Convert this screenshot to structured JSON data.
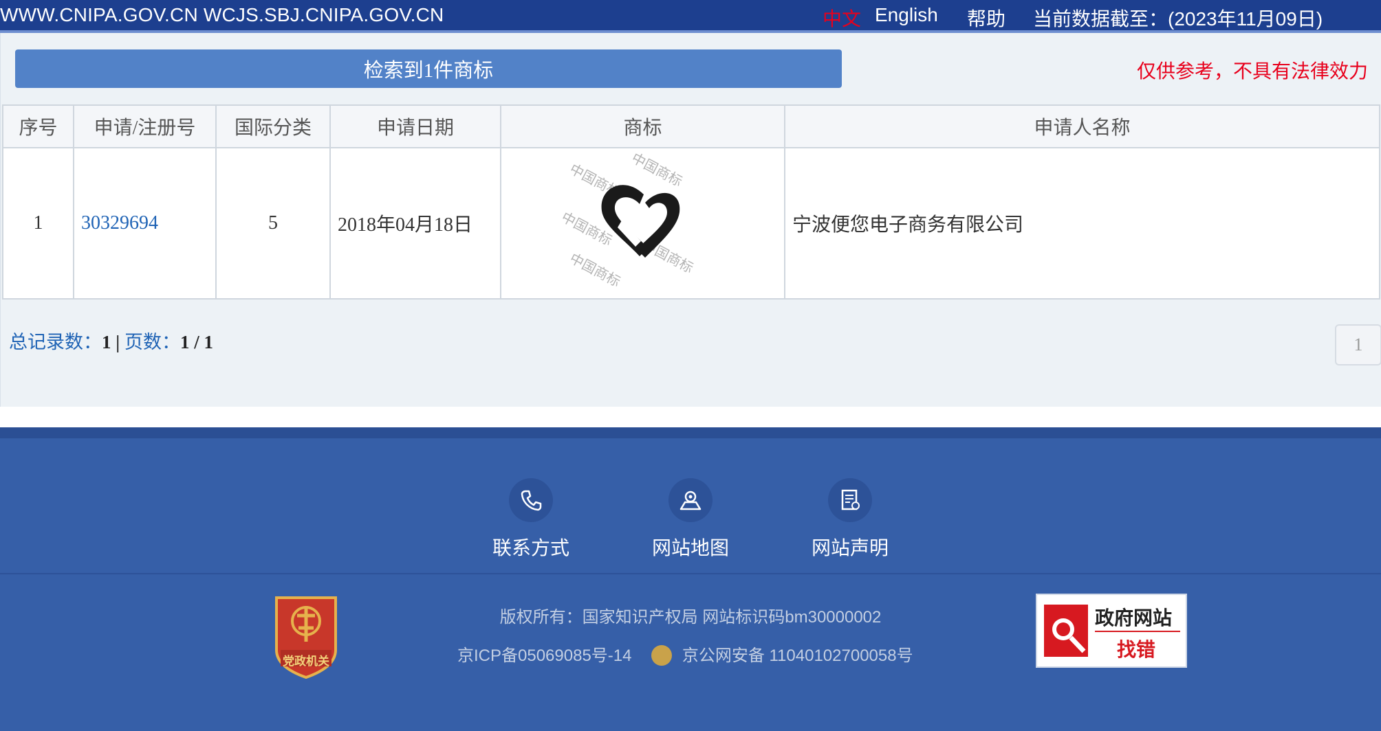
{
  "header": {
    "domains": "WWW.CNIPA.GOV.CN WCJS.SBJ.CNIPA.GOV.CN",
    "lang_zh": "中文",
    "lang_en": "English",
    "help": "帮助",
    "data_cutoff": "当前数据截至：(2023年11月09日)"
  },
  "result": {
    "count_label": "检索到1件商标",
    "disclaimer": "仅供参考，不具有法律效力"
  },
  "table": {
    "headers": [
      "序号",
      "申请/注册号",
      "国际分类",
      "申请日期",
      "商标",
      "申请人名称"
    ],
    "rows": [
      {
        "index": "1",
        "reg_no": "30329694",
        "intl_class": "5",
        "app_date": "2018年04月18日",
        "watermark_text": "中国商标",
        "applicant": "宁波便您电子商务有限公司"
      }
    ]
  },
  "pagination": {
    "total_label": "总记录数：",
    "total": "1",
    "separator": "|",
    "pages_label": "页数：",
    "pages": "1 / 1",
    "current_page": "1"
  },
  "footer": {
    "links": [
      "联系方式",
      "网站地图",
      "网站声明"
    ],
    "copyright": "版权所有：国家知识产权局 网站标识码bm30000002",
    "icp": "京ICP备05069085号-14",
    "police": "京公网安备 11040102700058号",
    "badge_text": "党政机关",
    "gov_error_title": "政府网站",
    "gov_error_sub": "找错"
  },
  "colors": {
    "header_bg": "#1d3f8f",
    "result_bar": "#5282c8",
    "disclaimer_red": "#e8001c",
    "footer_bg": "#365fa8",
    "link_blue": "#1f63b5"
  }
}
